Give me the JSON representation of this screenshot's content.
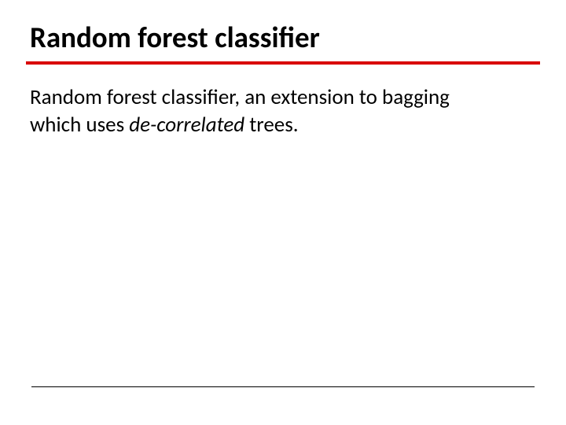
{
  "slide": {
    "title": "Random forest classifier",
    "body": {
      "part1": "Random forest classifier, an extension to bagging which uses ",
      "italic": "de-correlated",
      "part2": " trees."
    }
  }
}
